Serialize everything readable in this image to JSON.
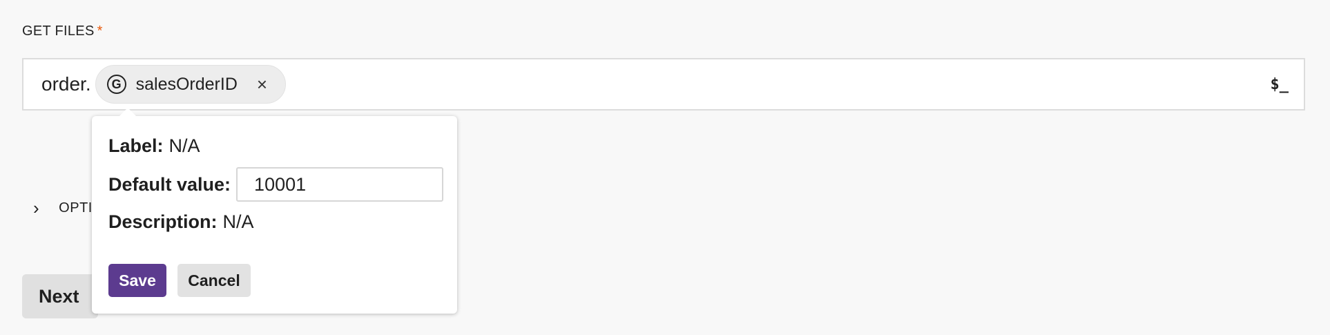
{
  "field": {
    "label": "GET FILES",
    "required_mark": "*",
    "prefix": "order.",
    "chip": {
      "icon_letter": "G",
      "name": "salesOrderID",
      "close_glyph": "×"
    },
    "terminal_icon": "$_"
  },
  "options": {
    "chevron": "›",
    "label": "OPTI"
  },
  "next_label": "Next",
  "popover": {
    "label_key": "Label:",
    "label_value": "N/A",
    "default_key": "Default value:",
    "default_value": "10001",
    "description_key": "Description:",
    "description_value": "N/A",
    "save_label": "Save",
    "cancel_label": "Cancel"
  },
  "colors": {
    "accent": "#5c3b8f",
    "required": "#e8590c"
  }
}
